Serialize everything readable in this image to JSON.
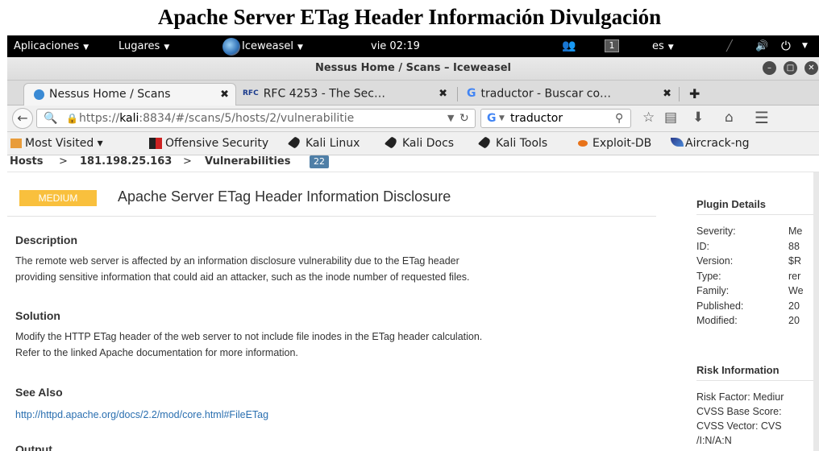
{
  "caption": "Apache Server ETag Header Información Divulgación",
  "topbar": {
    "applications": "Aplicaciones",
    "places": "Lugares",
    "app": "Iceweasel",
    "clock": "vie 02:19",
    "workspace": "1",
    "language": "es"
  },
  "window": {
    "title": "Nessus Home / Scans – Iceweasel"
  },
  "tabs": [
    {
      "label": "Nessus Home / Scans",
      "icon": "nessus-icon"
    },
    {
      "label": "RFC 4253 - The Sec…",
      "icon": "rfc-icon"
    },
    {
      "label": "traductor - Buscar co…",
      "icon": "google-icon"
    }
  ],
  "navbar": {
    "url_host": "kali",
    "url_prefix": "https://",
    "url_rest": ":8834/#/scans/5/hosts/2/vulnerabilitie",
    "search_value": "traductor",
    "search_engine": "G"
  },
  "bookmarks": [
    {
      "label": "Most Visited ▾"
    },
    {
      "label": "Offensive Security"
    },
    {
      "label": "Kali Linux"
    },
    {
      "label": "Kali Docs"
    },
    {
      "label": "Kali Tools"
    },
    {
      "label": "Exploit-DB"
    },
    {
      "label": "Aircrack-ng"
    }
  ],
  "breadcrumb": {
    "hosts": "Hosts",
    "host_ip": "181.198.25.163",
    "vulns": "Vulnerabilities",
    "count": "22"
  },
  "vuln": {
    "severity": "MEDIUM",
    "title": "Apache Server ETag Header Information Disclosure",
    "description_heading": "Description",
    "description_line1": "The remote web server is affected by an information disclosure vulnerability due to the ETag header",
    "description_line2": "providing sensitive information that could aid an attacker, such as the inode number of requested files.",
    "solution_heading": "Solution",
    "solution_line1": "Modify the HTTP ETag header of the web server to not include file inodes in the ETag header calculation.",
    "solution_line2": "Refer to the linked Apache documentation for more information.",
    "see_also_heading": "See Also",
    "see_also_link": "http://httpd.apache.org/docs/2.2/mod/core.html#FileETag",
    "output_heading": "Output"
  },
  "plugin_details": {
    "heading": "Plugin Details",
    "rows": [
      {
        "label": "Severity:",
        "value": "Me"
      },
      {
        "label": "ID:",
        "value": "88"
      },
      {
        "label": "Version:",
        "value": "$R"
      },
      {
        "label": "Type:",
        "value": "rer"
      },
      {
        "label": "Family:",
        "value": "We"
      },
      {
        "label": "Published:",
        "value": "20"
      },
      {
        "label": "Modified:",
        "value": "20"
      }
    ]
  },
  "risk_info": {
    "heading": "Risk Information",
    "rows": [
      "Risk Factor:  Mediur",
      "CVSS Base Score:",
      "CVSS Vector:  CVS",
      "/I:N/A:N"
    ]
  },
  "colors": {
    "severity_medium": "#f9c03d",
    "link": "#2a6fb0",
    "topbar": "#000000"
  }
}
